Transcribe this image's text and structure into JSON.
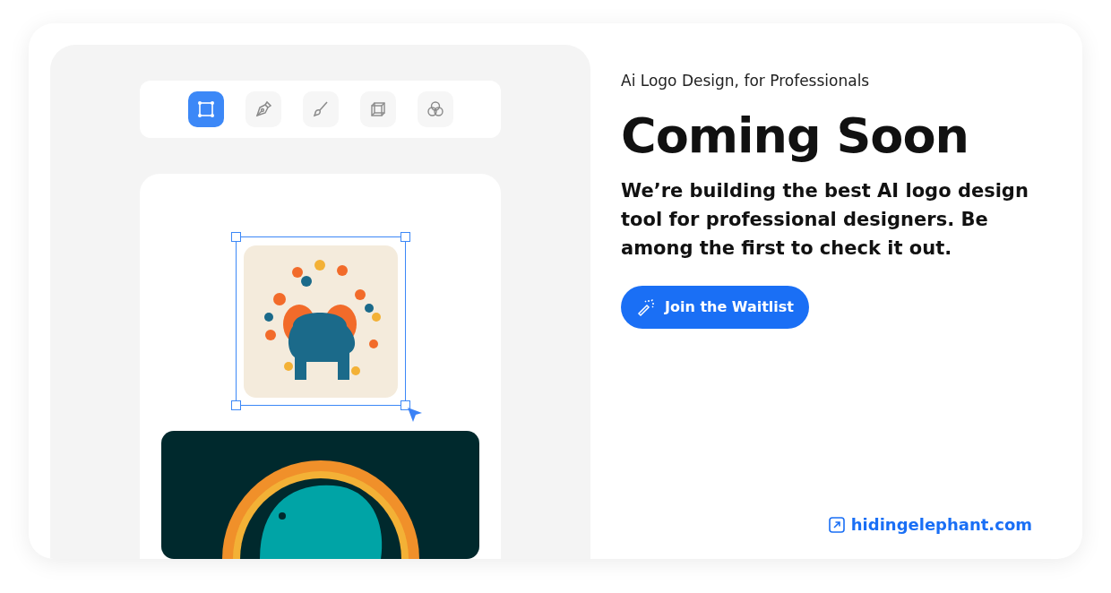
{
  "tools": [
    {
      "kind": "select",
      "selected": true
    },
    {
      "kind": "pen",
      "selected": false
    },
    {
      "kind": "brush",
      "selected": false
    },
    {
      "kind": "cube",
      "selected": false
    },
    {
      "kind": "blend",
      "selected": false
    }
  ],
  "tagline": "Ai Logo Design, for Professionals",
  "heading": "Coming Soon",
  "description": "We’re building the best AI logo design tool for professional designers. Be among the first to check it out.",
  "cta": {
    "label": "Join the Waitlist"
  },
  "link": {
    "label": "hidingelephant.com"
  }
}
